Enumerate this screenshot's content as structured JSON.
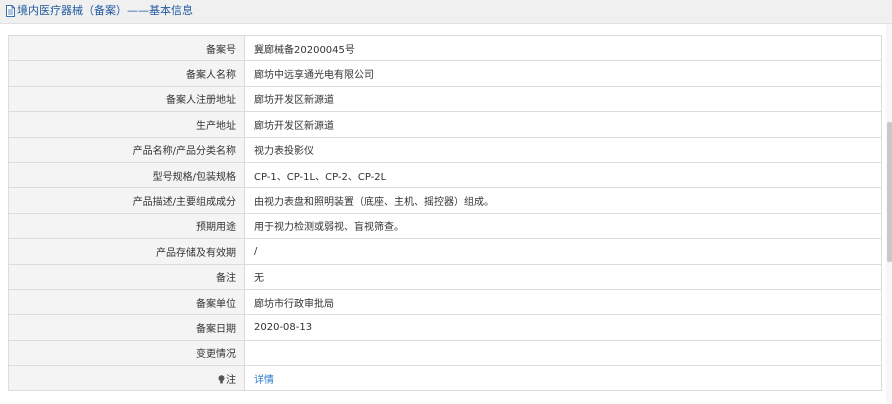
{
  "header": {
    "title": "境内医疗器械（备案）——基本信息"
  },
  "record": {
    "rows": [
      {
        "label": "备案号",
        "value": "冀廊械备20200045号"
      },
      {
        "label": "备案人名称",
        "value": "廊坊中远享通光电有限公司"
      },
      {
        "label": "备案人注册地址",
        "value": "廊坊开发区新源道"
      },
      {
        "label": "生产地址",
        "value": "廊坊开发区新源道"
      },
      {
        "label": "产品名称/产品分类名称",
        "value": "视力表投影仪"
      },
      {
        "label": "型号规格/包装规格",
        "value": "CP-1、CP-1L、CP-2、CP-2L"
      },
      {
        "label": "产品描述/主要组成成分",
        "value": "由视力表盘和照明装置（底座、主机、摇控器）组成。"
      },
      {
        "label": "预期用途",
        "value": "用于视力检测或弱视、盲视筛查。"
      },
      {
        "label": "产品存储及有效期",
        "value": "/"
      },
      {
        "label": "备注",
        "value": "无"
      },
      {
        "label": "备案单位",
        "value": "廊坊市行政审批局"
      },
      {
        "label": "备案日期",
        "value": "2020-08-13"
      },
      {
        "label": "变更情况",
        "value": ""
      }
    ],
    "note": {
      "label": "注",
      "icon": "bulb-icon",
      "link_text": "详情"
    }
  },
  "colors": {
    "title_text": "#1f5a9e",
    "link": "#2a7ac8",
    "label_background": "#f4f4f4",
    "border": "#dcdcdc"
  }
}
